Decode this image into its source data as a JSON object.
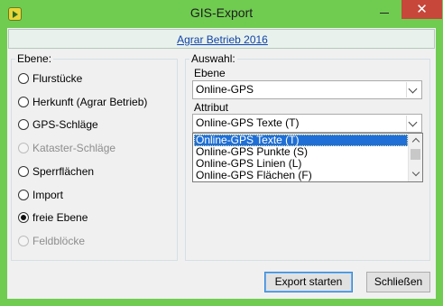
{
  "window": {
    "title": "GIS-Export",
    "close_glyph": "✕"
  },
  "icons": {
    "app": "app-icon",
    "minimize": "minimize-icon",
    "close": "close-icon"
  },
  "colors": {
    "frame": "#70cc51",
    "close": "#c7473a",
    "selection": "#1f6fd6",
    "link": "#1144aa"
  },
  "header": {
    "link_text": "Agrar Betrieb 2016"
  },
  "ebene": {
    "label": "Ebene:",
    "options": [
      {
        "label": "Flurstücke",
        "enabled": true,
        "checked": false
      },
      {
        "label": "Herkunft (Agrar Betrieb)",
        "enabled": true,
        "checked": false
      },
      {
        "label": "GPS-Schläge",
        "enabled": true,
        "checked": false
      },
      {
        "label": "Kataster-Schläge",
        "enabled": false,
        "checked": false
      },
      {
        "label": "Sperrflächen",
        "enabled": true,
        "checked": false
      },
      {
        "label": "Import",
        "enabled": true,
        "checked": false
      },
      {
        "label": "freie Ebene",
        "enabled": true,
        "checked": true
      },
      {
        "label": "Feldblöcke",
        "enabled": false,
        "checked": false
      }
    ]
  },
  "auswahl": {
    "label": "Auswahl:",
    "ebene_label": "Ebene",
    "ebene_value": "Online-GPS",
    "attribut_label": "Attribut",
    "attribut_value": "Online-GPS Texte (T)",
    "attribut_options": [
      "Online-GPS Texte (T)",
      "Online-GPS Punkte (S)",
      "Online-GPS Linien (L)",
      "Online-GPS Flächen (F)"
    ],
    "attribut_selected_index": 0
  },
  "buttons": {
    "export": "Export starten",
    "close": "Schließen"
  }
}
